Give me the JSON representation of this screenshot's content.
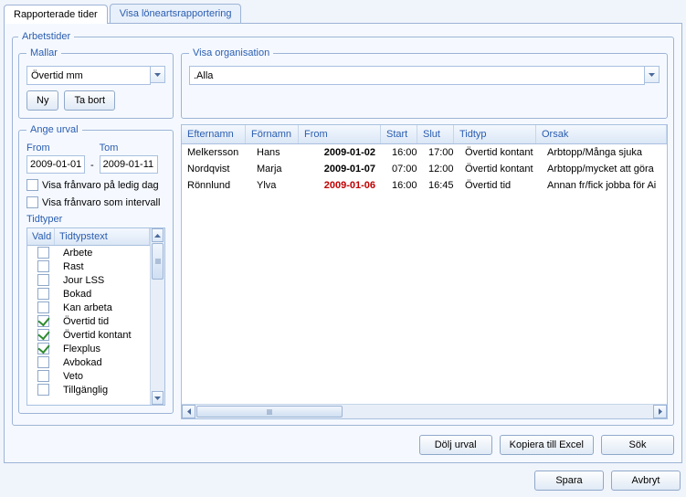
{
  "tabs": {
    "active": "Rapporterade tider",
    "inactive": "Visa löneartsrapportering"
  },
  "mallar": {
    "legend": "Mallar",
    "selected": "Övertid mm",
    "ny_label": "Ny",
    "tabort_label": "Ta bort"
  },
  "visa_org": {
    "legend": "Visa organisation",
    "selected": ".Alla"
  },
  "ange": {
    "legend": "Ange urval",
    "from_label": "From",
    "tom_label": "Tom",
    "from_value": "2009-01-01",
    "tom_value": "2009-01-11",
    "chk_ledig": "Visa frånvaro på ledig dag",
    "chk_intervall": "Visa frånvaro som intervall",
    "tidtyper_label": "Tidtyper",
    "tid_hdr_vald": "Vald",
    "tid_hdr_text": "Tidtypstext",
    "tidtyper": [
      {
        "label": "Arbete",
        "checked": false
      },
      {
        "label": "Rast",
        "checked": false
      },
      {
        "label": "Jour LSS",
        "checked": false
      },
      {
        "label": "Bokad",
        "checked": false
      },
      {
        "label": "Kan arbeta",
        "checked": false
      },
      {
        "label": "Övertid tid",
        "checked": true
      },
      {
        "label": "Övertid kontant",
        "checked": true
      },
      {
        "label": "Flexplus",
        "checked": true
      },
      {
        "label": "Avbokad",
        "checked": false
      },
      {
        "label": "Veto",
        "checked": false
      },
      {
        "label": "Tillgänglig",
        "checked": false
      }
    ]
  },
  "grid": {
    "headers": {
      "efternamn": "Efternamn",
      "fornamn": "Förnamn",
      "from": "From",
      "start": "Start",
      "slut": "Slut",
      "tidtyp": "Tidtyp",
      "orsak": "Orsak"
    },
    "rows": [
      {
        "efternamn": "Melkersson",
        "fornamn": "Hans",
        "from": "2009-01-02",
        "start": "16:00",
        "slut": "17:00",
        "tidtyp": "Övertid kontant",
        "orsak": "Arbtopp/Många sjuka",
        "red": false
      },
      {
        "efternamn": "Nordqvist",
        "fornamn": "Marja",
        "from": "2009-01-07",
        "start": "07:00",
        "slut": "12:00",
        "tidtyp": "Övertid kontant",
        "orsak": "Arbtopp/mycket att göra",
        "red": false
      },
      {
        "efternamn": "Rönnlund",
        "fornamn": "Ylva",
        "from": "2009-01-06",
        "start": "16:00",
        "slut": "16:45",
        "tidtyp": "Övertid tid",
        "orsak": "Annan fr/fick jobba för Ai",
        "red": true
      }
    ]
  },
  "buttons": {
    "dolj_urval": "Dölj urval",
    "kopiera": "Kopiera till Excel",
    "sok": "Sök",
    "spara": "Spara",
    "avbryt": "Avbryt"
  }
}
